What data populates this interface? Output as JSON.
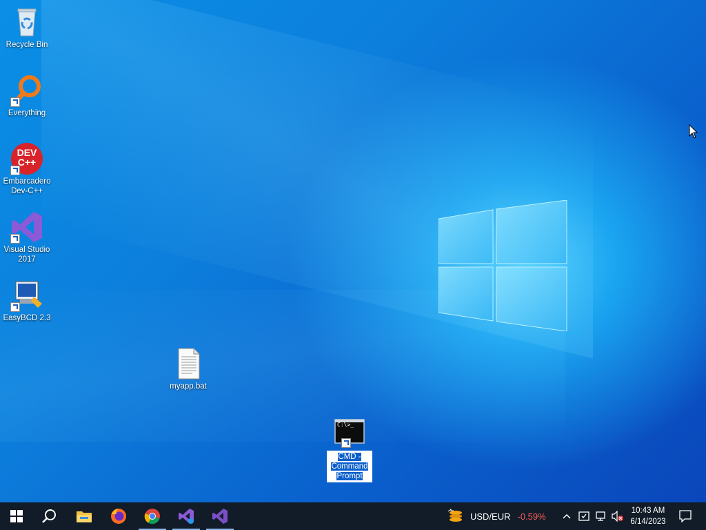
{
  "desktop": {
    "icons": [
      {
        "label": "Recycle Bin",
        "icon": "recycle-bin-icon"
      },
      {
        "label": "Everything",
        "icon": "everything-search-icon"
      },
      {
        "label": "Embarcadero Dev-C++",
        "icon": "devcpp-icon",
        "glyph": "DEV\nC++"
      },
      {
        "label": "Visual Studio 2017",
        "icon": "visual-studio-icon"
      },
      {
        "label": "EasyBCD 2.3",
        "icon": "easybcd-icon"
      },
      {
        "label": "myapp.bat",
        "icon": "batch-file-icon"
      },
      {
        "label": "CMD - Command Prompt",
        "icon": "cmd-icon",
        "glyph": "C:\\>_",
        "selected": true
      }
    ]
  },
  "taskbar": {
    "apps": [
      "start-icon",
      "search-icon",
      "file-explorer-icon",
      "firefox-icon",
      "chrome-icon",
      "visual-studio-icon",
      "visual-studio-2017-icon"
    ],
    "ticker": {
      "pair": "USD/EUR",
      "change": "-0.59%",
      "change_color": "#ff5b5b"
    },
    "clock": {
      "time": "10:43 AM",
      "date": "6/14/2023"
    }
  },
  "colors": {
    "taskbar": "#111c28",
    "selection": "#0a5fcc"
  }
}
